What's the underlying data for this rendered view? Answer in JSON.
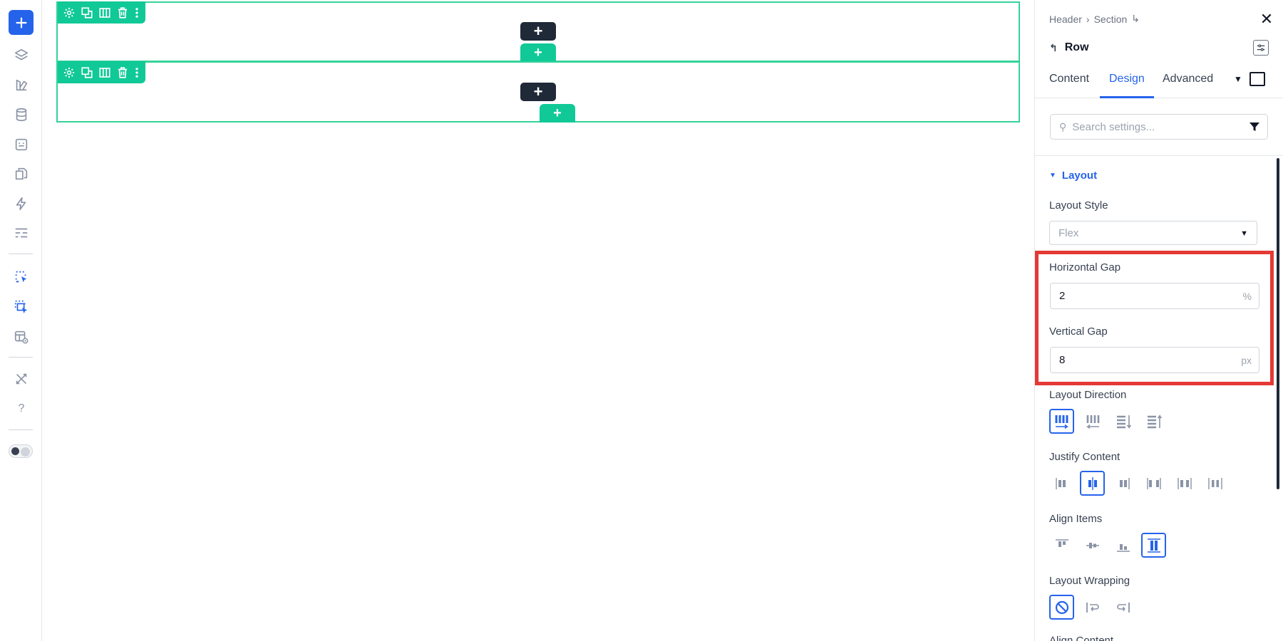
{
  "left_toolbar": {
    "add_label": "+",
    "icons": [
      "layers-icon",
      "palette-icon",
      "database-icon",
      "form-icon",
      "pages-icon",
      "lightning-icon",
      "sections-icon",
      "select-pointer-icon",
      "multi-select-pointer-icon",
      "layout-preview-icon",
      "tools-icon",
      "help-icon"
    ],
    "help_label": "?"
  },
  "canvas": {
    "add_label": "+",
    "rows": [
      {
        "tools": [
          "gear-icon",
          "duplicate-icon",
          "columns-icon",
          "trash-icon",
          "more-icon"
        ]
      },
      {
        "tools": [
          "gear-icon",
          "duplicate-icon",
          "columns-icon",
          "trash-icon",
          "more-icon"
        ]
      }
    ]
  },
  "panel": {
    "breadcrumb": {
      "items": [
        "Header",
        "Section"
      ],
      "separator": "›",
      "trail_icon": "↳"
    },
    "close_label": "✕",
    "element_title": "Row",
    "back_icon": "↰",
    "tabs": [
      "Content",
      "Design",
      "Advanced"
    ],
    "active_tab": "Design",
    "search": {
      "placeholder": "Search settings...",
      "value": ""
    },
    "layout": {
      "heading": "Layout",
      "layout_style_label": "Layout Style",
      "layout_style_value": "Flex",
      "horizontal_gap_label": "Horizontal Gap",
      "horizontal_gap_value": "2",
      "horizontal_gap_unit": "%",
      "vertical_gap_label": "Vertical Gap",
      "vertical_gap_value": "8",
      "vertical_gap_unit": "px",
      "direction_label": "Layout Direction",
      "justify_label": "Justify Content",
      "align_label": "Align Items",
      "wrap_label": "Layout Wrapping",
      "align_content_label": "Align Content"
    },
    "colors": {
      "accent": "#2563eb",
      "canvas_green": "#10c997",
      "highlight": "#e53935"
    }
  }
}
